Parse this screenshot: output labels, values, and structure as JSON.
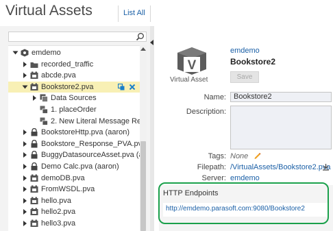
{
  "header": {
    "title": "Virtual Assets",
    "list_all": "List All"
  },
  "tree": {
    "items": [
      {
        "label": "emdemo",
        "icon": "server-gear-icon",
        "toggle": "expanded",
        "depth": 0
      },
      {
        "label": "recorded_traffic",
        "icon": "folder-icon",
        "toggle": "collapsed",
        "depth": 1
      },
      {
        "label": "abcde.pva",
        "icon": "asset-icon",
        "toggle": "collapsed",
        "depth": 1
      },
      {
        "label": "Bookstore2.pva",
        "icon": "asset-icon",
        "toggle": "expanded",
        "depth": 1,
        "selected": true
      },
      {
        "label": "Data Sources",
        "icon": "datasource-icon",
        "toggle": "collapsed",
        "depth": 2
      },
      {
        "label": "1. placeOrder",
        "icon": "responder-icon",
        "toggle": "",
        "depth": 2
      },
      {
        "label": "2. New Literal Message Res",
        "icon": "responder-icon",
        "toggle": "",
        "depth": 2
      },
      {
        "label": "BookstoreHttp.pva (aaron)",
        "icon": "lock-icon",
        "toggle": "collapsed",
        "depth": 1
      },
      {
        "label": "Bookstore_Response_PVA.pva",
        "icon": "lock-icon",
        "toggle": "collapsed",
        "depth": 1
      },
      {
        "label": "BuggyDatasourceAsset.pva (ad",
        "icon": "lock-icon",
        "toggle": "collapsed",
        "depth": 1
      },
      {
        "label": "Demo Calc.pva (aaron)",
        "icon": "lock-icon",
        "toggle": "collapsed",
        "depth": 1
      },
      {
        "label": "demoDB.pva",
        "icon": "asset-icon",
        "toggle": "collapsed",
        "depth": 1
      },
      {
        "label": "FromWSDL.pva",
        "icon": "asset-icon",
        "toggle": "collapsed",
        "depth": 1
      },
      {
        "label": "hello.pva",
        "icon": "asset-icon",
        "toggle": "collapsed",
        "depth": 1
      },
      {
        "label": "hello2.pva",
        "icon": "asset-icon",
        "toggle": "collapsed",
        "depth": 1
      },
      {
        "label": "hello3.pva",
        "icon": "asset-icon",
        "toggle": "collapsed",
        "depth": 1
      }
    ]
  },
  "detail": {
    "icon_caption": "Virtual Asset",
    "breadcrumb": "emdemo",
    "asset_name": "Bookstore2",
    "save_label": "Save",
    "name_label": "Name:",
    "name_value": "Bookstore2",
    "description_label": "Description:",
    "description_value": "",
    "tags_label": "Tags:",
    "tags_value": "None",
    "filepath_label": "Filepath:",
    "filepath_value": "/VirtualAssets/Bookstore2.pva",
    "server_label": "Server:",
    "server_value": "emdemo",
    "http_title": "HTTP Endpoints",
    "http_url": "http://emdemo.parasoft.com:9080/Bookstore2"
  },
  "colors": {
    "link": "#1a5fa6",
    "selected_row": "#f8f0b5",
    "highlight": "#1aa04b",
    "action_icons": "#1a7fc9"
  }
}
